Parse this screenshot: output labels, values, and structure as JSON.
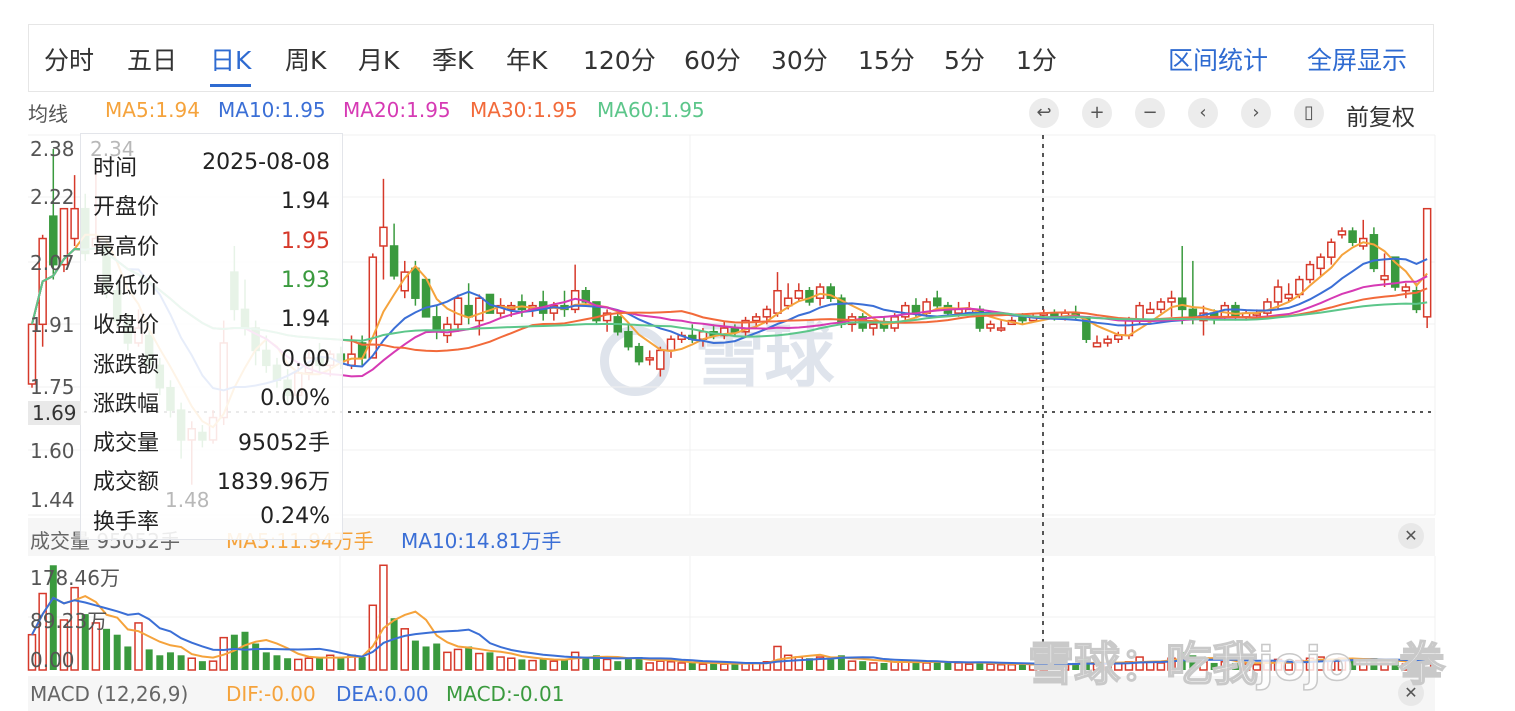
{
  "tabs": [
    {
      "label": "分时"
    },
    {
      "label": "五日"
    },
    {
      "label": "日K",
      "active": true
    },
    {
      "label": "周K"
    },
    {
      "label": "月K"
    },
    {
      "label": "季K"
    },
    {
      "label": "年K"
    },
    {
      "label": "120分"
    },
    {
      "label": "60分"
    },
    {
      "label": "30分"
    },
    {
      "label": "15分"
    },
    {
      "label": "5分"
    },
    {
      "label": "1分"
    }
  ],
  "actions": {
    "range_stats": "区间统计",
    "fullscreen": "全屏显示"
  },
  "ma_legend": {
    "title": "均线",
    "ma5": "MA5:1.94",
    "ma10": "MA10:1.95",
    "ma20": "MA20:1.95",
    "ma30": "MA30:1.95",
    "ma60": "MA60:1.95"
  },
  "controls": [
    "reset-icon",
    "zoom-in-icon",
    "zoom-out-icon",
    "prev-icon",
    "next-icon",
    "candle-icon"
  ],
  "adjust": "前复权",
  "colors": {
    "up": "#d6392a",
    "down": "#3a9a3e",
    "ma5": "#f5a33c",
    "ma10": "#3b6fd6",
    "ma20": "#d63ab4",
    "ma30": "#f26a3a",
    "ma60": "#5cc68a",
    "accent": "#2f6bd1"
  },
  "price_axis": [
    "2.38",
    "2.22",
    "2.07",
    "1.91",
    "1.75",
    "1.60",
    "1.44"
  ],
  "crosshair_price": "1.69",
  "extreme_labels": {
    "high": "2.34",
    "low": "1.48"
  },
  "tooltip": [
    {
      "k": "时间",
      "v": "2025-08-08"
    },
    {
      "k": "开盘价",
      "v": "1.94"
    },
    {
      "k": "最高价",
      "v": "1.95",
      "c": "up"
    },
    {
      "k": "最低价",
      "v": "1.93",
      "c": "down"
    },
    {
      "k": "收盘价",
      "v": "1.94"
    },
    {
      "k": "涨跌额",
      "v": "0.00"
    },
    {
      "k": "涨跌幅",
      "v": "0.00%"
    },
    {
      "k": "成交量",
      "v": "95052手"
    },
    {
      "k": "成交额",
      "v": "1839.96万"
    },
    {
      "k": "换手率",
      "v": "0.24%"
    }
  ],
  "volume": {
    "title": "成交量 95052手",
    "ma5": "MA5:11.94万手",
    "ma10": "MA10:14.81万手",
    "axis": [
      "178.46万",
      "89.23万",
      "0.00"
    ]
  },
  "macd": {
    "title": "MACD (12,26,9)",
    "dif": "DIF:-0.00",
    "dea": "DEA:0.00",
    "macd": "MACD:-0.01"
  },
  "watermark": "雪球",
  "watermark2": "雪球：吃我jojo一拳",
  "chart_data": {
    "type": "candlestick",
    "ylim": [
      1.44,
      2.38
    ],
    "volume_max": 178.46,
    "volume_unit": "万手",
    "ohlc": [
      [
        1.75,
        1.91,
        1.74,
        1.91
      ],
      [
        1.91,
        2.15,
        1.85,
        2.14
      ],
      [
        2.2,
        2.38,
        2.03,
        2.07
      ],
      [
        2.07,
        2.22,
        2.05,
        2.22
      ],
      [
        2.14,
        2.31,
        2.12,
        2.22
      ],
      [
        2.22,
        2.26,
        2.08,
        2.1
      ],
      [
        2.12,
        2.34,
        2.1,
        2.14
      ],
      [
        2.12,
        2.14,
        1.98,
        2.0
      ],
      [
        2.0,
        2.03,
        1.9,
        1.92
      ],
      [
        1.92,
        1.94,
        1.84,
        1.86
      ],
      [
        1.86,
        1.95,
        1.85,
        1.9
      ],
      [
        1.88,
        1.9,
        1.78,
        1.8
      ],
      [
        1.8,
        1.82,
        1.72,
        1.74
      ],
      [
        1.74,
        1.76,
        1.66,
        1.68
      ],
      [
        1.68,
        1.7,
        1.55,
        1.6
      ],
      [
        1.6,
        1.65,
        1.48,
        1.63
      ],
      [
        1.62,
        1.64,
        1.58,
        1.6
      ],
      [
        1.6,
        1.68,
        1.59,
        1.66
      ],
      [
        1.66,
        1.92,
        1.64,
        1.86
      ],
      [
        2.05,
        2.12,
        1.92,
        1.95
      ],
      [
        1.95,
        2.03,
        1.88,
        1.9
      ],
      [
        1.9,
        1.92,
        1.8,
        1.84
      ],
      [
        1.84,
        1.88,
        1.78,
        1.8
      ],
      [
        1.8,
        1.82,
        1.74,
        1.76
      ],
      [
        1.76,
        1.79,
        1.7,
        1.72
      ],
      [
        1.72,
        1.8,
        1.7,
        1.78
      ],
      [
        1.78,
        1.84,
        1.76,
        1.82
      ],
      [
        1.82,
        1.86,
        1.78,
        1.8
      ],
      [
        1.8,
        1.84,
        1.77,
        1.83
      ],
      [
        1.83,
        1.85,
        1.79,
        1.81
      ],
      [
        1.8,
        1.88,
        1.79,
        1.83
      ],
      [
        1.86,
        1.88,
        1.8,
        1.82
      ],
      [
        1.82,
        2.1,
        1.82,
        2.09
      ],
      [
        2.12,
        2.3,
        2.03,
        2.17
      ],
      [
        2.12,
        2.18,
        2.03,
        2.04
      ],
      [
        2.0,
        2.08,
        1.98,
        2.05
      ],
      [
        2.06,
        2.08,
        1.96,
        1.98
      ],
      [
        2.03,
        2.03,
        1.93,
        1.93
      ],
      [
        1.93,
        1.96,
        1.87,
        1.89
      ],
      [
        1.88,
        1.93,
        1.86,
        1.91
      ],
      [
        1.91,
        1.99,
        1.89,
        1.98
      ],
      [
        1.96,
        2.02,
        1.91,
        1.93
      ],
      [
        1.92,
        1.99,
        1.88,
        1.98
      ],
      [
        1.99,
        1.99,
        1.94,
        1.94
      ],
      [
        1.94,
        1.98,
        1.93,
        1.96
      ],
      [
        1.95,
        1.97,
        1.93,
        1.96
      ],
      [
        1.97,
        1.99,
        1.93,
        1.95
      ],
      [
        1.95,
        1.97,
        1.93,
        1.96
      ],
      [
        1.97,
        2.0,
        1.92,
        1.94
      ],
      [
        1.94,
        1.97,
        1.92,
        1.96
      ],
      [
        1.96,
        2.0,
        1.93,
        1.95
      ],
      [
        1.95,
        2.07,
        1.94,
        2.0
      ],
      [
        2.0,
        2.01,
        1.96,
        1.97
      ],
      [
        1.97,
        1.97,
        1.91,
        1.92
      ],
      [
        1.92,
        1.95,
        1.89,
        1.94
      ],
      [
        1.93,
        1.94,
        1.88,
        1.89
      ],
      [
        1.89,
        1.91,
        1.84,
        1.85
      ],
      [
        1.85,
        1.86,
        1.8,
        1.81
      ],
      [
        1.82,
        1.84,
        1.8,
        1.82
      ],
      [
        1.79,
        1.85,
        1.77,
        1.84
      ],
      [
        1.84,
        1.88,
        1.82,
        1.87
      ],
      [
        1.87,
        1.89,
        1.86,
        1.88
      ],
      [
        1.88,
        1.91,
        1.86,
        1.87
      ],
      [
        1.87,
        1.9,
        1.85,
        1.89
      ],
      [
        1.89,
        1.91,
        1.87,
        1.88
      ],
      [
        1.88,
        1.92,
        1.87,
        1.9
      ],
      [
        1.9,
        1.91,
        1.88,
        1.89
      ],
      [
        1.89,
        1.93,
        1.88,
        1.92
      ],
      [
        1.92,
        1.94,
        1.9,
        1.93
      ],
      [
        1.93,
        1.96,
        1.91,
        1.95
      ],
      [
        1.94,
        2.05,
        1.93,
        2.0
      ],
      [
        1.96,
        2.02,
        1.95,
        1.98
      ],
      [
        1.98,
        2.02,
        1.97,
        2.0
      ],
      [
        2.0,
        2.01,
        1.96,
        1.97
      ],
      [
        1.98,
        2.02,
        1.96,
        2.01
      ],
      [
        2.01,
        2.02,
        1.97,
        1.98
      ],
      [
        1.98,
        1.99,
        1.9,
        1.91
      ],
      [
        1.91,
        1.94,
        1.89,
        1.93
      ],
      [
        1.93,
        1.94,
        1.89,
        1.9
      ],
      [
        1.9,
        1.92,
        1.88,
        1.91
      ],
      [
        1.91,
        1.93,
        1.89,
        1.9
      ],
      [
        1.9,
        1.94,
        1.89,
        1.93
      ],
      [
        1.93,
        1.97,
        1.92,
        1.96
      ],
      [
        1.96,
        1.98,
        1.93,
        1.94
      ],
      [
        1.94,
        1.98,
        1.93,
        1.97
      ],
      [
        1.98,
        2.0,
        1.95,
        1.96
      ],
      [
        1.96,
        1.97,
        1.93,
        1.94
      ],
      [
        1.94,
        1.97,
        1.93,
        1.95
      ],
      [
        1.94,
        1.97,
        1.94,
        1.95
      ],
      [
        1.95,
        1.96,
        1.89,
        1.9
      ],
      [
        1.9,
        1.92,
        1.89,
        1.91
      ],
      [
        1.9,
        1.92,
        1.89,
        1.9
      ],
      [
        1.91,
        1.93,
        1.91,
        1.92
      ],
      [
        1.93,
        1.94,
        1.91,
        1.92
      ],
      [
        1.92,
        1.94,
        1.92,
        1.93
      ],
      [
        1.94,
        1.95,
        1.93,
        1.94
      ],
      [
        1.94,
        1.95,
        1.92,
        1.93
      ],
      [
        1.93,
        1.95,
        1.92,
        1.94
      ],
      [
        1.94,
        1.96,
        1.92,
        1.93
      ],
      [
        1.93,
        1.93,
        1.86,
        1.87
      ],
      [
        1.85,
        1.88,
        1.85,
        1.86
      ],
      [
        1.86,
        1.88,
        1.85,
        1.87
      ],
      [
        1.87,
        1.89,
        1.86,
        1.88
      ],
      [
        1.88,
        1.93,
        1.87,
        1.92
      ],
      [
        1.92,
        1.97,
        1.91,
        1.96
      ],
      [
        1.94,
        1.97,
        1.94,
        1.95
      ],
      [
        1.95,
        1.98,
        1.94,
        1.97
      ],
      [
        1.97,
        2.0,
        1.93,
        1.98
      ],
      [
        1.98,
        2.12,
        1.91,
        1.95
      ],
      [
        1.95,
        2.08,
        1.91,
        1.93
      ],
      [
        1.92,
        1.96,
        1.88,
        1.94
      ],
      [
        1.94,
        1.95,
        1.91,
        1.93
      ],
      [
        1.93,
        1.97,
        1.92,
        1.96
      ],
      [
        1.96,
        1.97,
        1.92,
        1.93
      ],
      [
        1.93,
        1.95,
        1.92,
        1.94
      ],
      [
        1.94,
        1.95,
        1.93,
        1.94
      ],
      [
        1.94,
        1.98,
        1.93,
        1.97
      ],
      [
        1.97,
        2.03,
        1.95,
        2.01
      ],
      [
        1.98,
        2.02,
        1.97,
        1.99
      ],
      [
        1.99,
        2.04,
        1.98,
        2.03
      ],
      [
        2.03,
        2.08,
        2.02,
        2.07
      ],
      [
        2.06,
        2.1,
        2.04,
        2.09
      ],
      [
        2.09,
        2.14,
        2.07,
        2.13
      ],
      [
        2.15,
        2.17,
        2.14,
        2.16
      ],
      [
        2.16,
        2.17,
        2.12,
        2.13
      ],
      [
        2.12,
        2.19,
        2.11,
        2.14
      ],
      [
        2.15,
        2.17,
        2.05,
        2.06
      ],
      [
        2.03,
        2.1,
        2.01,
        2.04
      ],
      [
        2.09,
        2.09,
        2.0,
        2.01
      ],
      [
        2.0,
        2.02,
        1.98,
        2.01
      ],
      [
        2.0,
        2.02,
        1.94,
        1.95
      ],
      [
        1.93,
        2.22,
        1.9,
        2.22
      ]
    ],
    "volumes": [
      60,
      130,
      178,
      85,
      140,
      95,
      80,
      70,
      60,
      40,
      80,
      35,
      25,
      30,
      25,
      20,
      15,
      15,
      55,
      60,
      65,
      45,
      30,
      25,
      20,
      18,
      20,
      22,
      25,
      20,
      25,
      22,
      110,
      178,
      88,
      70,
      50,
      40,
      45,
      30,
      35,
      40,
      28,
      30,
      22,
      20,
      18,
      16,
      20,
      15,
      18,
      30,
      22,
      25,
      18,
      15,
      20,
      22,
      12,
      15,
      14,
      12,
      12,
      10,
      12,
      10,
      10,
      12,
      11,
      14,
      40,
      25,
      22,
      20,
      22,
      18,
      25,
      15,
      15,
      12,
      12,
      14,
      15,
      14,
      12,
      15,
      13,
      12,
      10,
      14,
      10,
      9,
      9,
      10,
      9,
      9.5,
      9,
      10,
      12,
      20,
      10,
      10,
      11,
      14,
      22,
      14,
      12,
      20,
      30,
      25,
      14,
      12,
      14,
      12,
      10,
      9,
      14,
      18,
      12,
      16,
      20,
      22,
      18,
      20,
      18,
      16,
      20,
      12,
      15,
      10,
      12,
      25
    ]
  }
}
